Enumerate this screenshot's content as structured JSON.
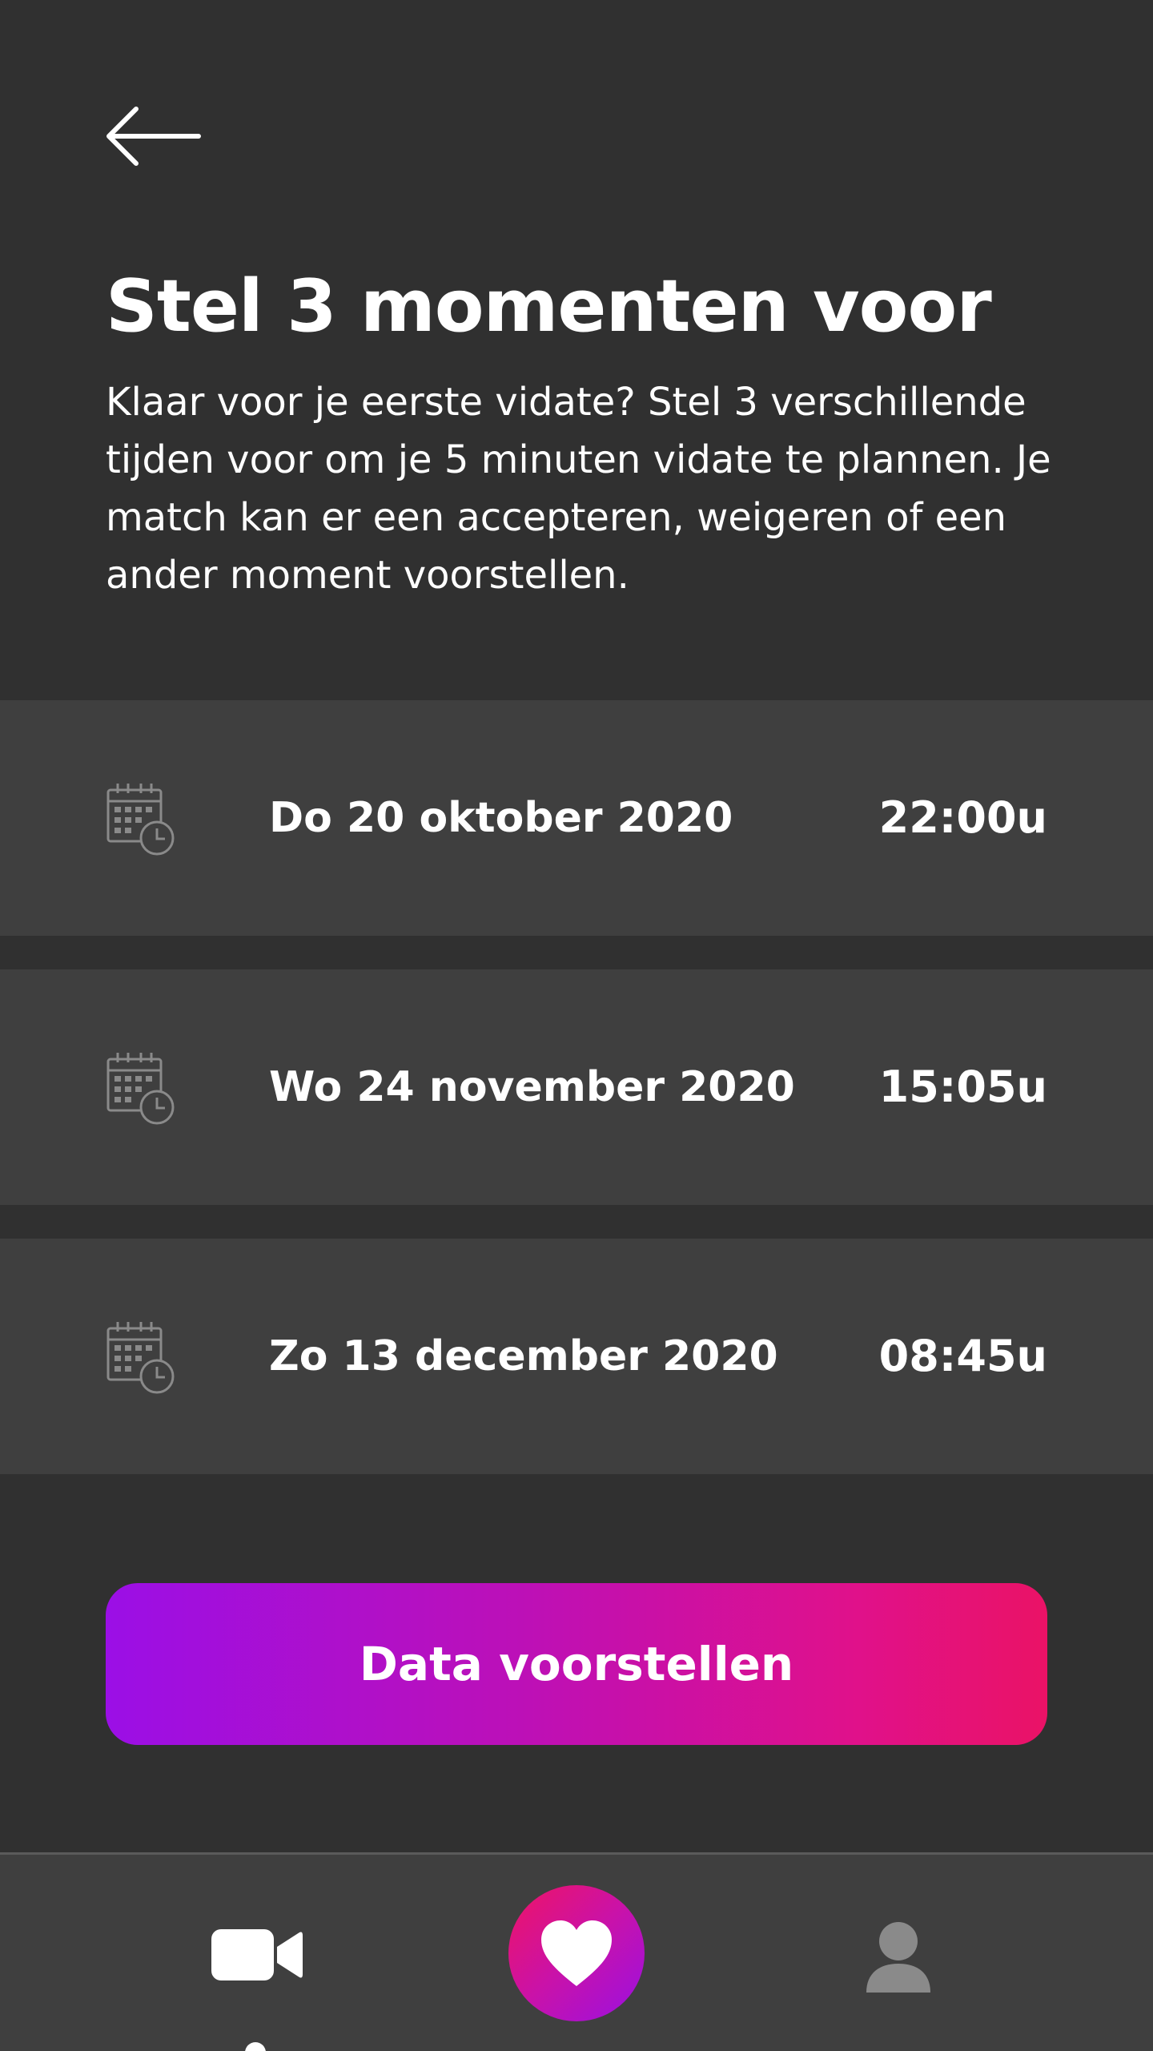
{
  "header": {
    "back_icon": "arrow-left-icon",
    "title": "Stel 3 momenten voor",
    "intro": "Klaar voor je eerste vidate? Stel 3 verschillende tijden voor om je 5 minuten vidate te plannen. Je match kan er een accepteren, weigeren of een ander moment voorstellen."
  },
  "moments": [
    {
      "icon": "calendar-clock-icon",
      "date": "Do 20 oktober 2020",
      "time": "22:00u"
    },
    {
      "icon": "calendar-clock-icon",
      "date": "Wo 24 november 2020",
      "time": "15:05u"
    },
    {
      "icon": "calendar-clock-icon",
      "date": "Zo 13 december 2020",
      "time": "08:45u"
    }
  ],
  "submit": {
    "label": "Data voorstellen"
  },
  "nav": {
    "items": [
      {
        "icon": "video-camera-icon",
        "active": true
      },
      {
        "icon": "heart-icon",
        "active": false
      },
      {
        "icon": "user-icon",
        "active": false
      }
    ]
  },
  "colors": {
    "background": "#303030",
    "row_background": "#3f3f3f",
    "gradient_start": "#9b0fe6",
    "gradient_end": "#ea1266",
    "text": "#ffffff",
    "icon_muted": "#8a8a8a"
  }
}
